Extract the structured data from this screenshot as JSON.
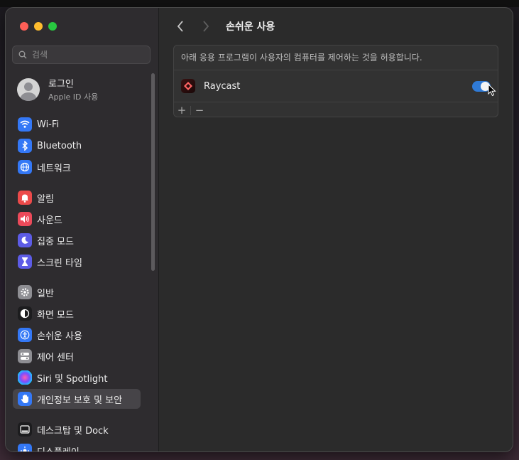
{
  "window": {
    "traffic_lights": [
      "close",
      "minimize",
      "zoom"
    ]
  },
  "search": {
    "placeholder": "검색"
  },
  "account": {
    "name": "로그인",
    "subtitle": "Apple ID 사용"
  },
  "sidebar": {
    "items": [
      {
        "label": "Wi-Fi",
        "icon": "wifi-icon",
        "color": "#3478f6"
      },
      {
        "label": "Bluetooth",
        "icon": "bluetooth-icon",
        "color": "#3478f6"
      },
      {
        "label": "네트워크",
        "icon": "globe-icon",
        "color": "#3478f6"
      },
      {
        "label": "알림",
        "icon": "bell-icon",
        "color": "#ec4a4a"
      },
      {
        "label": "사운드",
        "icon": "speaker-icon",
        "color": "#ec4a5a"
      },
      {
        "label": "집중 모드",
        "icon": "moon-icon",
        "color": "#5d5ce6"
      },
      {
        "label": "스크린 타임",
        "icon": "hourglass-icon",
        "color": "#5d5ce6"
      },
      {
        "label": "일반",
        "icon": "gear-icon",
        "color": "#8e8e93"
      },
      {
        "label": "화면 모드",
        "icon": "appearance-icon",
        "color": "#1c1c1e"
      },
      {
        "label": "손쉬운 사용",
        "icon": "accessibility-icon",
        "color": "#3478f6"
      },
      {
        "label": "제어 센터",
        "icon": "control-center-icon",
        "color": "#8e8e93"
      },
      {
        "label": "Siri 및 Spotlight",
        "icon": "siri-icon",
        "color": "#2b2b2b"
      },
      {
        "label": "개인정보 보호 및 보안",
        "icon": "hand-icon",
        "color": "#3478f6",
        "selected": true
      },
      {
        "label": "데스크탑 및 Dock",
        "icon": "dock-icon",
        "color": "#1c1c1e"
      },
      {
        "label": "디스플레이",
        "icon": "display-icon",
        "color": "#3478f6"
      }
    ]
  },
  "main": {
    "title": "손쉬운 사용",
    "description": "아래 응용 프로그램이 사용자의 컴퓨터를 제어하는 것을 허용합니다.",
    "apps": [
      {
        "name": "Raycast",
        "enabled": true
      }
    ],
    "add_label": "+",
    "remove_label": "−"
  },
  "colors": {
    "accent": "#2f7ad6",
    "selected_bg": "#464448"
  }
}
